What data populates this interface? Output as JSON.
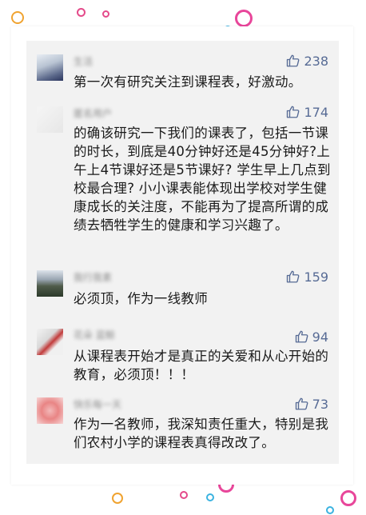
{
  "comments": [
    {
      "user": "生活",
      "likes": "238",
      "text": "第一次有研究关注到课程表，好激动。"
    },
    {
      "user": "匿名用户",
      "likes": "174",
      "text": "的确该研究一下我们的课表了，包括一节课的时长，到底是40分钟好还是45分钟好?上午上4节课好还是5节课好? 学生早上几点到校最合理? 小小课表能体现出学校对学生健康成长的关注度，不能再为了提高所谓的成绩去牺牲学生的健康和学习兴趣了。"
    },
    {
      "user": "我行我素",
      "likes": "159",
      "text": "必须顶，作为一线教师"
    },
    {
      "user": "花朵 蓝鲸",
      "likes": "94",
      "text": "从课程表开始才是真正的关爱和从心开始的教育，必须顶！！！"
    },
    {
      "user": "快乐每一天",
      "likes": "73",
      "text": "作为一名教师，我深知责任重大，特别是我们农村小学的课程表真得改改了。"
    }
  ],
  "icons": {
    "like": "thumbs-up-icon",
    "decor": "swirl-icon"
  },
  "colors": {
    "card_bg": "#f2f2f2",
    "like_color": "#576b95",
    "text_color": "#1a1a1a"
  }
}
